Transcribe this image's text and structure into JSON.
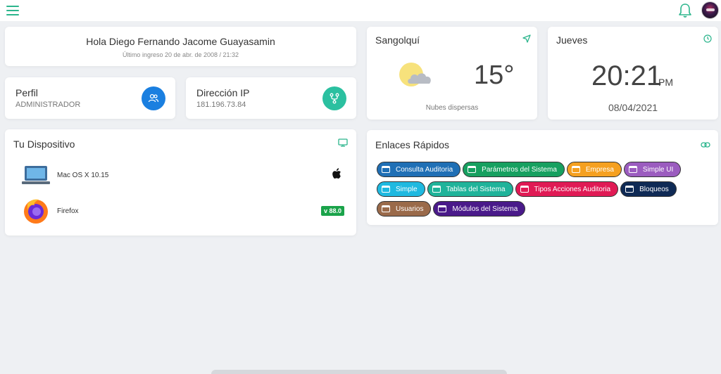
{
  "header": {},
  "greeting": {
    "name": "Hola Diego Fernando Jacome Guayasamin",
    "last_login": "Último ingreso 20 de abr. de 2008 / 21:32"
  },
  "profile": {
    "title": "Perfil",
    "value": "ADMINISTRADOR",
    "color": "#1a7fe0"
  },
  "ip": {
    "title": "Dirección IP",
    "value": "181.196.73.84",
    "color": "#2bc0a0"
  },
  "weather": {
    "city": "Sangolquí",
    "temp": "15°",
    "description": "Nubes dispersas"
  },
  "clock": {
    "day": "Jueves",
    "time": "20:21",
    "ampm": "PM",
    "date": "08/04/2021"
  },
  "device": {
    "title": "Tu Dispositivo",
    "os": "Mac OS X 10.15",
    "browser": "Firefox",
    "browser_version": "v 88.0"
  },
  "links": {
    "title": "Enlaces Rápidos",
    "items": [
      {
        "label": "Consulta Auditoria",
        "color": "#1f6fb5"
      },
      {
        "label": "Parámetros del Sistema",
        "color": "#17a060"
      },
      {
        "label": "Empresa",
        "color": "#f5a020"
      },
      {
        "label": "Simple UI",
        "color": "#9b5cbf"
      },
      {
        "label": "Simple",
        "color": "#1fb9e0"
      },
      {
        "label": "Tablas del Sistema",
        "color": "#1fb39a"
      },
      {
        "label": "Tipos Acciones Auditoria",
        "color": "#e01a55"
      },
      {
        "label": "Bloqueos",
        "color": "#0f2a55"
      },
      {
        "label": "Usuarios",
        "color": "#9a6a4a"
      },
      {
        "label": "Módulos del Sistema",
        "color": "#4a1a8a"
      }
    ]
  }
}
